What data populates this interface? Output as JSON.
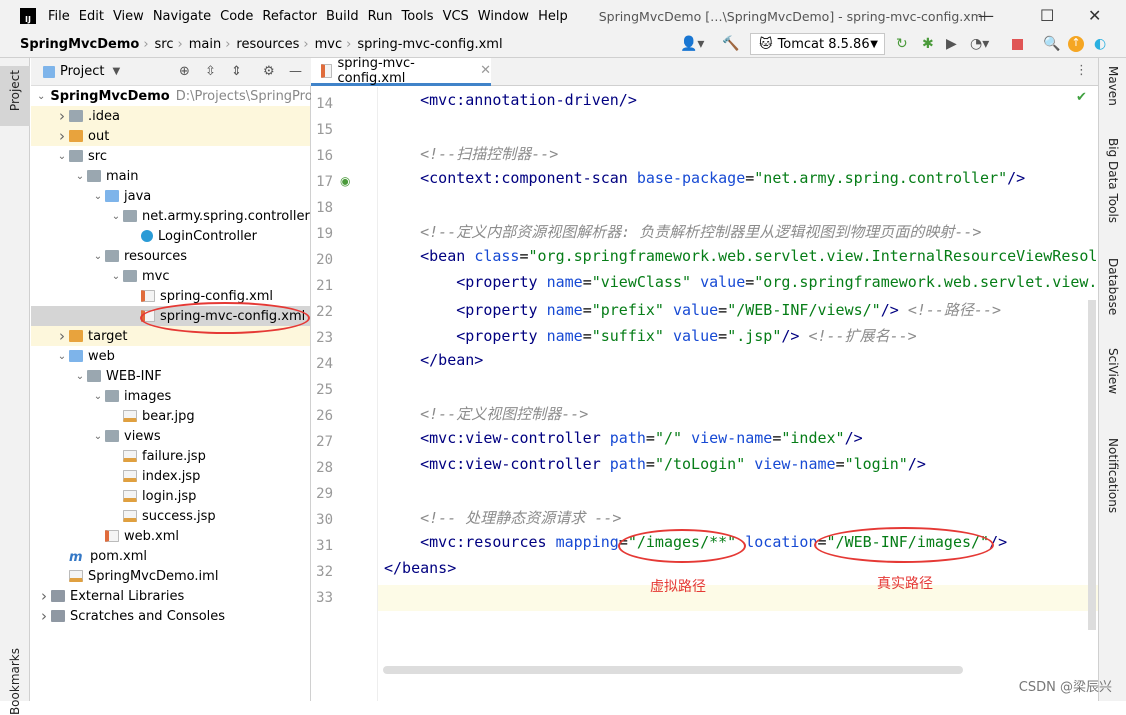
{
  "titlebar": {
    "menus": [
      "File",
      "Edit",
      "View",
      "Navigate",
      "Code",
      "Refactor",
      "Build",
      "Run",
      "Tools",
      "VCS",
      "Window",
      "Help"
    ],
    "title": "SpringMvcDemo […\\SpringMvcDemo] - spring-mvc-config.xml"
  },
  "breadcrumb": [
    "SpringMvcDemo",
    "src",
    "main",
    "resources",
    "mvc",
    "spring-mvc-config.xml"
  ],
  "run_config": "Tomcat 8.5.86",
  "project_panel": {
    "title": "Project"
  },
  "left_stripe": {
    "project": "Project",
    "bookmarks": "Bookmarks"
  },
  "right_stripe": [
    "Maven",
    "Big Data Tools",
    "Database",
    "SciView",
    "Notifications"
  ],
  "tree": [
    {
      "level": 0,
      "arrow": "down",
      "icon": "fold-blue",
      "label": "SpringMvcDemo",
      "extra": "D:\\Projects\\SpringProj",
      "bold": true
    },
    {
      "level": 1,
      "arrow": "right",
      "icon": "fold",
      "label": ".idea",
      "state": "hl"
    },
    {
      "level": 1,
      "arrow": "right",
      "icon": "fold-orange",
      "label": "out",
      "state": "hl"
    },
    {
      "level": 1,
      "arrow": "down",
      "icon": "fold",
      "label": "src"
    },
    {
      "level": 2,
      "arrow": "down",
      "icon": "fold",
      "label": "main"
    },
    {
      "level": 3,
      "arrow": "down",
      "icon": "fold-blue",
      "label": "java"
    },
    {
      "level": 4,
      "arrow": "down",
      "icon": "fold",
      "label": "net.army.spring.controller"
    },
    {
      "level": 5,
      "arrow": "",
      "icon": "cls",
      "label": "LoginController"
    },
    {
      "level": 3,
      "arrow": "down",
      "icon": "fold",
      "label": "resources"
    },
    {
      "level": 4,
      "arrow": "down",
      "icon": "fold",
      "label": "mvc"
    },
    {
      "level": 5,
      "arrow": "",
      "icon": "file-xml",
      "label": "spring-config.xml"
    },
    {
      "level": 5,
      "arrow": "",
      "icon": "file-xml",
      "label": "spring-mvc-config.xml",
      "state": "sel"
    },
    {
      "level": 1,
      "arrow": "right",
      "icon": "fold-orange",
      "label": "target",
      "state": "hl"
    },
    {
      "level": 1,
      "arrow": "down",
      "icon": "fold-blue",
      "label": "web"
    },
    {
      "level": 2,
      "arrow": "down",
      "icon": "fold",
      "label": "WEB-INF"
    },
    {
      "level": 3,
      "arrow": "down",
      "icon": "fold",
      "label": "images"
    },
    {
      "level": 4,
      "arrow": "",
      "icon": "file-jsp",
      "label": "bear.jpg"
    },
    {
      "level": 3,
      "arrow": "down",
      "icon": "fold",
      "label": "views"
    },
    {
      "level": 4,
      "arrow": "",
      "icon": "file-jsp",
      "label": "failure.jsp"
    },
    {
      "level": 4,
      "arrow": "",
      "icon": "file-jsp",
      "label": "index.jsp"
    },
    {
      "level": 4,
      "arrow": "",
      "icon": "file-jsp",
      "label": "login.jsp"
    },
    {
      "level": 4,
      "arrow": "",
      "icon": "file-jsp",
      "label": "success.jsp"
    },
    {
      "level": 3,
      "arrow": "",
      "icon": "file-xml",
      "label": "web.xml"
    },
    {
      "level": 1,
      "arrow": "",
      "icon": "m",
      "label": "pom.xml"
    },
    {
      "level": 1,
      "arrow": "",
      "icon": "file-jsp",
      "label": "SpringMvcDemo.iml"
    },
    {
      "level": 0,
      "arrow": "right",
      "icon": "lib",
      "label": "External Libraries"
    },
    {
      "level": 0,
      "arrow": "right",
      "icon": "lib",
      "label": "Scratches and Consoles"
    }
  ],
  "editor_tab": "spring-mvc-config.xml",
  "code": [
    {
      "n": "14",
      "t": [
        [
          "pl",
          "    "
        ],
        [
          "tag",
          "<mvc:annotation-driven/>"
        ]
      ]
    },
    {
      "n": "15",
      "t": []
    },
    {
      "n": "16",
      "t": [
        [
          "pl",
          "    "
        ],
        [
          "cmt",
          "<!--扫描控制器-->"
        ]
      ]
    },
    {
      "n": "17",
      "t": [
        [
          "pl",
          "    "
        ],
        [
          "tag",
          "<context:component-scan "
        ],
        [
          "attr",
          "base-package"
        ],
        [
          "pl",
          "="
        ],
        [
          "val",
          "\"net.army.spring.controller\""
        ],
        [
          "tag",
          "/>"
        ]
      ]
    },
    {
      "n": "18",
      "t": []
    },
    {
      "n": "19",
      "t": [
        [
          "pl",
          "    "
        ],
        [
          "cmt",
          "<!--定义内部资源视图解析器: 负责解析控制器里从逻辑视图到物理页面的映射-->"
        ]
      ]
    },
    {
      "n": "20",
      "t": [
        [
          "pl",
          "    "
        ],
        [
          "tag",
          "<bean "
        ],
        [
          "attr",
          "class"
        ],
        [
          "pl",
          "="
        ],
        [
          "val",
          "\"org.springframework.web.servlet.view.InternalResourceViewResolver\""
        ]
      ]
    },
    {
      "n": "21",
      "t": [
        [
          "pl",
          "        "
        ],
        [
          "tag",
          "<property "
        ],
        [
          "attr",
          "name"
        ],
        [
          "pl",
          "="
        ],
        [
          "val",
          "\"viewClass\" "
        ],
        [
          "attr",
          "value"
        ],
        [
          "pl",
          "="
        ],
        [
          "val",
          "\"org.springframework.web.servlet.view.JstlView\""
        ]
      ]
    },
    {
      "n": "22",
      "t": [
        [
          "pl",
          "        "
        ],
        [
          "tag",
          "<property "
        ],
        [
          "attr",
          "name"
        ],
        [
          "pl",
          "="
        ],
        [
          "val",
          "\"prefix\" "
        ],
        [
          "attr",
          "value"
        ],
        [
          "pl",
          "="
        ],
        [
          "val",
          "\"/WEB-INF/views/\""
        ],
        [
          "tag",
          "/> "
        ],
        [
          "cmt",
          "<!--路径-->"
        ]
      ]
    },
    {
      "n": "23",
      "t": [
        [
          "pl",
          "        "
        ],
        [
          "tag",
          "<property "
        ],
        [
          "attr",
          "name"
        ],
        [
          "pl",
          "="
        ],
        [
          "val",
          "\"suffix\" "
        ],
        [
          "attr",
          "value"
        ],
        [
          "pl",
          "="
        ],
        [
          "val",
          "\".jsp\""
        ],
        [
          "tag",
          "/> "
        ],
        [
          "cmt",
          "<!--扩展名-->"
        ]
      ]
    },
    {
      "n": "24",
      "t": [
        [
          "pl",
          "    "
        ],
        [
          "tag",
          "</bean>"
        ]
      ]
    },
    {
      "n": "25",
      "t": []
    },
    {
      "n": "26",
      "t": [
        [
          "pl",
          "    "
        ],
        [
          "cmt",
          "<!--定义视图控制器-->"
        ]
      ]
    },
    {
      "n": "27",
      "t": [
        [
          "pl",
          "    "
        ],
        [
          "tag",
          "<mvc:view-controller "
        ],
        [
          "attr",
          "path"
        ],
        [
          "pl",
          "="
        ],
        [
          "val",
          "\"/\" "
        ],
        [
          "attr",
          "view-name"
        ],
        [
          "pl",
          "="
        ],
        [
          "val",
          "\"index\""
        ],
        [
          "tag",
          "/>"
        ]
      ]
    },
    {
      "n": "28",
      "t": [
        [
          "pl",
          "    "
        ],
        [
          "tag",
          "<mvc:view-controller "
        ],
        [
          "attr",
          "path"
        ],
        [
          "pl",
          "="
        ],
        [
          "val",
          "\"/toLogin\" "
        ],
        [
          "attr",
          "view-name"
        ],
        [
          "pl",
          "="
        ],
        [
          "val",
          "\"login\""
        ],
        [
          "tag",
          "/>"
        ]
      ]
    },
    {
      "n": "29",
      "t": []
    },
    {
      "n": "30",
      "t": [
        [
          "pl",
          "    "
        ],
        [
          "cmt",
          "<!-- 处理静态资源请求 -->"
        ]
      ]
    },
    {
      "n": "31",
      "t": [
        [
          "pl",
          "    "
        ],
        [
          "tag",
          "<mvc:resources "
        ],
        [
          "attr",
          "mapping"
        ],
        [
          "pl",
          "="
        ],
        [
          "val",
          "\"/images/**\" "
        ],
        [
          "attr",
          "location"
        ],
        [
          "pl",
          "="
        ],
        [
          "val",
          "\"/WEB-INF/images/\""
        ],
        [
          "tag",
          "/>"
        ]
      ]
    },
    {
      "n": "32",
      "t": [
        [
          "tag",
          "</beans>"
        ]
      ]
    },
    {
      "n": "33",
      "t": []
    }
  ],
  "annotations": {
    "virtual_path": "虚拟路径",
    "real_path": "真实路径"
  },
  "watermark": "CSDN @梁辰兴"
}
